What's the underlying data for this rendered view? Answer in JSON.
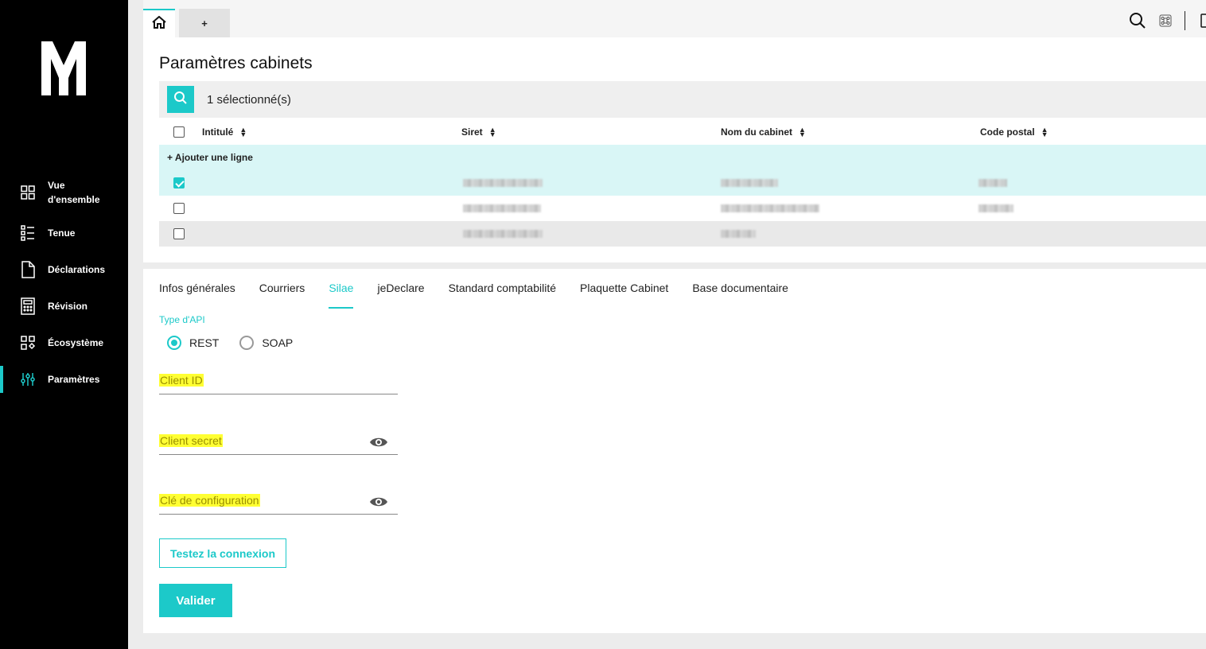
{
  "sidebar": {
    "items": [
      {
        "label": "Vue d'ensemble",
        "label_line1": "Vue",
        "label_line2": "d'ensemble",
        "icon": "grid-icon"
      },
      {
        "label": "Tenue",
        "icon": "list-icon"
      },
      {
        "label": "Déclarations",
        "icon": "document-icon"
      },
      {
        "label": "Révision",
        "icon": "calculator-icon"
      },
      {
        "label": "Écosystème",
        "icon": "ecosystem-icon"
      },
      {
        "label": "Paramètres",
        "icon": "sliders-icon",
        "active": true
      }
    ]
  },
  "tabs": {
    "add_label": "+"
  },
  "page": {
    "title": "Paramètres cabinets"
  },
  "toolbar": {
    "selection_text": "1 sélectionné(s)"
  },
  "table": {
    "columns": [
      "Intitulé",
      "Siret",
      "Nom du cabinet",
      "Code postal"
    ],
    "add_row_label": "+ Ajouter une ligne"
  },
  "detail_tabs": [
    "Infos générales",
    "Courriers",
    "Silae",
    "jeDeclare",
    "Standard comptabilité",
    "Plaquette Cabinet",
    "Base documentaire"
  ],
  "active_detail_tab": "Silae",
  "form": {
    "api_type_label": "Type d'API",
    "options": [
      "REST",
      "SOAP"
    ],
    "selected": "REST",
    "client_id_label": "Client ID",
    "client_secret_label": "Client secret",
    "config_key_label": "Clé de configuration",
    "test_button": "Testez la connexion",
    "submit_button": "Valider"
  },
  "colors": {
    "accent": "#1cc9c9",
    "sidebar": "#000000",
    "highlight": "#ffff33"
  }
}
